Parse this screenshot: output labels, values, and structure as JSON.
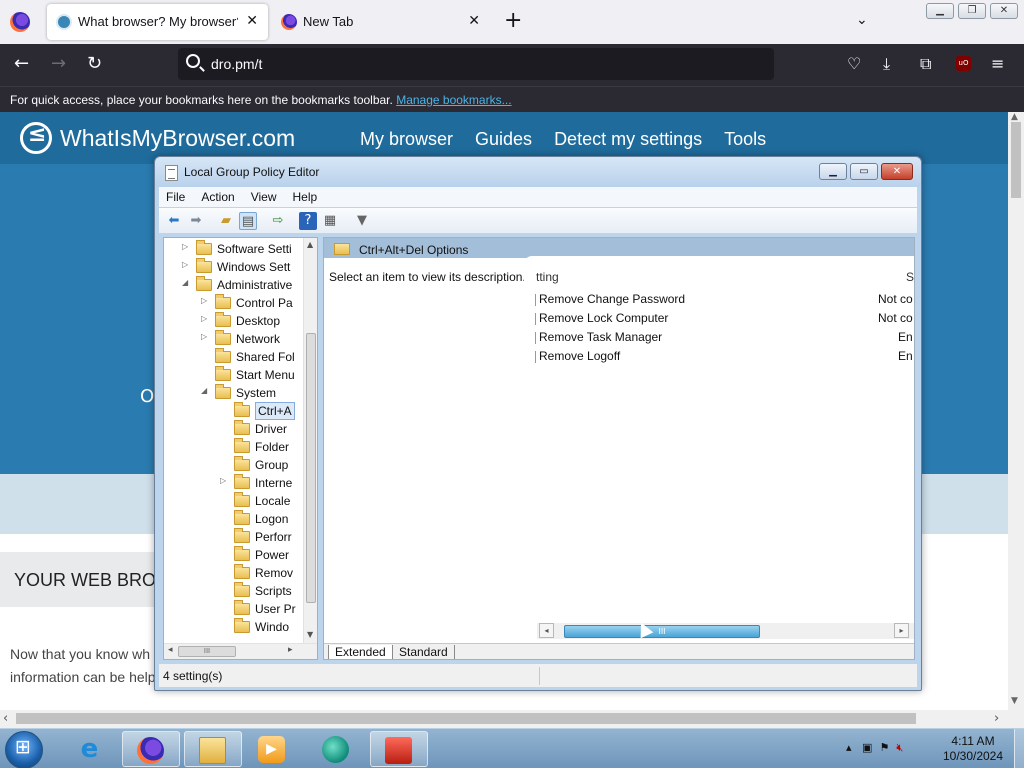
{
  "browser": {
    "tabs": [
      {
        "title": "What browser? My browser? Is"
      },
      {
        "title": "New Tab"
      }
    ],
    "url": "dro.pm/t",
    "bookmarks_bar_text": "For quick access, place your bookmarks here on the bookmarks toolbar.",
    "bookmarks_bar_link": "Manage bookmarks..."
  },
  "website": {
    "logo": "WhatIsMyBrowser.com",
    "nav": [
      "My browser",
      "Guides",
      "Detect my settings",
      "Tools"
    ],
    "hero_fragment": "O",
    "section_heading": "YOUR WEB BROW",
    "body_line_1": "Now that you know wh",
    "body_line_2": "information can be help"
  },
  "gpedit": {
    "title": "Local Group Policy Editor",
    "menus": [
      "File",
      "Action",
      "View",
      "Help"
    ],
    "tree": [
      {
        "label": "Software Setti",
        "indent": 0,
        "expander": "▷"
      },
      {
        "label": "Windows Sett",
        "indent": 0,
        "expander": "▷"
      },
      {
        "label": "Administrative",
        "indent": 0,
        "expander": "◢"
      },
      {
        "label": "Control Pa",
        "indent": 1,
        "expander": "▷"
      },
      {
        "label": "Desktop",
        "indent": 1,
        "expander": "▷"
      },
      {
        "label": "Network",
        "indent": 1,
        "expander": "▷"
      },
      {
        "label": "Shared Fol",
        "indent": 1,
        "expander": ""
      },
      {
        "label": "Start Menu",
        "indent": 1,
        "expander": ""
      },
      {
        "label": "System",
        "indent": 1,
        "expander": "◢"
      },
      {
        "label": "Ctrl+A",
        "indent": 2,
        "expander": "",
        "selected": true
      },
      {
        "label": "Driver",
        "indent": 2,
        "expander": ""
      },
      {
        "label": "Folder",
        "indent": 2,
        "expander": ""
      },
      {
        "label": "Group",
        "indent": 2,
        "expander": ""
      },
      {
        "label": "Interne",
        "indent": 2,
        "expander": "▷"
      },
      {
        "label": "Locale",
        "indent": 2,
        "expander": ""
      },
      {
        "label": "Logon",
        "indent": 2,
        "expander": ""
      },
      {
        "label": "Perforr",
        "indent": 2,
        "expander": ""
      },
      {
        "label": "Power",
        "indent": 2,
        "expander": ""
      },
      {
        "label": "Remov",
        "indent": 2,
        "expander": ""
      },
      {
        "label": "Scripts",
        "indent": 2,
        "expander": ""
      },
      {
        "label": "User Pr",
        "indent": 2,
        "expander": ""
      },
      {
        "label": "Windo",
        "indent": 2,
        "expander": ""
      }
    ],
    "right_header": "Ctrl+Alt+Del Options",
    "description": "Select an item to view its description.",
    "col_setting": "tting",
    "col_state": "S",
    "settings": [
      {
        "name": "Remove Change Password",
        "state": "Not co"
      },
      {
        "name": "Remove Lock Computer",
        "state": "Not co"
      },
      {
        "name": "Remove Task Manager",
        "state": "En"
      },
      {
        "name": "Remove Logoff",
        "state": "En"
      }
    ],
    "tab_extended": "Extended",
    "tab_standard": "Standard",
    "status": "4 setting(s)"
  },
  "taskbar": {
    "time": "4:11 AM",
    "date": "10/30/2024"
  },
  "colors": {
    "site_header": "#1f6b9c",
    "browser_dark": "#2b2a33",
    "selected_tree": "#dbe9f8"
  }
}
